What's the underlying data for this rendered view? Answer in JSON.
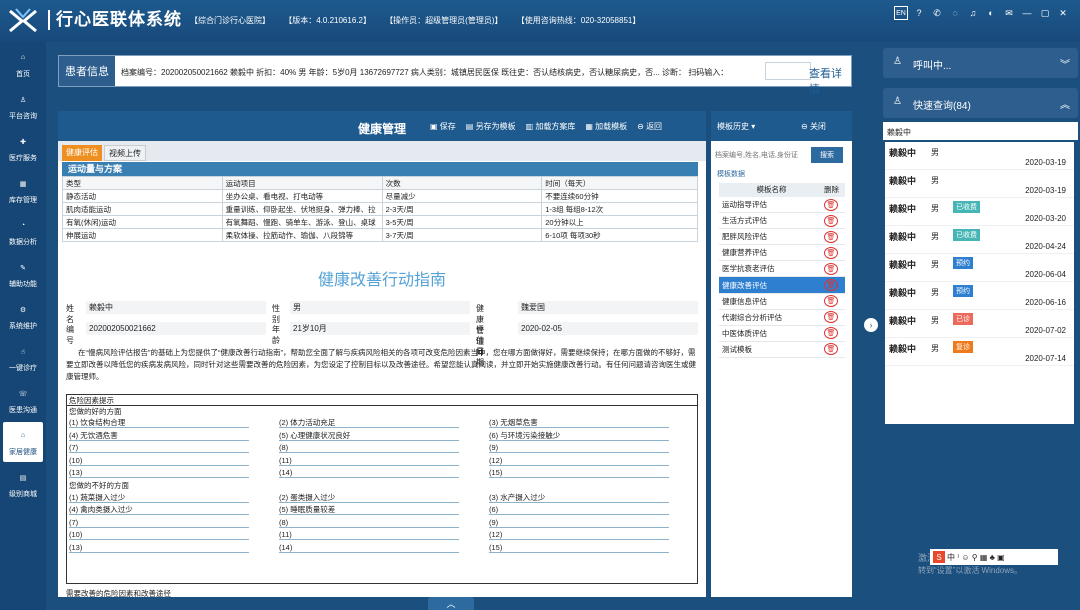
{
  "app": {
    "title": "行心医联体系统",
    "hospital": "【综合门诊行心医院】",
    "version": "【版本：4.0.210616.2】",
    "operator": "【操作员：超级管理员(管理员)】",
    "hotline": "【使用咨询热线：020-32058851】"
  },
  "top_icons": [
    "EN",
    "help-icon",
    "phone-icon",
    "chat-icon",
    "bell-icon",
    "headset-icon",
    "mail-icon",
    "minimize-icon",
    "restore-icon",
    "close-icon"
  ],
  "sidebar": [
    {
      "label": "首页",
      "icon": "home-icon"
    },
    {
      "label": "平台咨询",
      "icon": "doctor-icon"
    },
    {
      "label": "医疗服务",
      "icon": "medical-icon"
    },
    {
      "label": "库存管理",
      "icon": "warehouse-icon"
    },
    {
      "label": "数据分析",
      "icon": "chart-icon"
    },
    {
      "label": "辅助功能",
      "icon": "tools-icon"
    },
    {
      "label": "系统维护",
      "icon": "settings-icon"
    },
    {
      "label": "一键诊疗",
      "icon": "hand-icon"
    },
    {
      "label": "医患沟通",
      "icon": "chat-icon"
    },
    {
      "label": "家居健康",
      "icon": "house-icon"
    },
    {
      "label": "级别商城",
      "icon": "shop-icon"
    }
  ],
  "patient": {
    "label": "患者信息",
    "line": "档案编号：202002050021662   赖毅中   折扣：40%   男   年龄：5岁0月   13672697727   病人类别：城镇居民医保   既往史：否认结核病史，否认糖尿病史，否...   诊断：     扫码输入：",
    "detail": "查看详情"
  },
  "main": {
    "title": "健康管理",
    "buttons": [
      "保存",
      "另存为模板",
      "加载方案库",
      "加载模板",
      "返回"
    ],
    "tabs": [
      "健康评估",
      "视频上传"
    ],
    "section": "运动量与方案",
    "act_headers": [
      "类型",
      "运动项目",
      "次数",
      "时间（每天）"
    ],
    "act_rows": [
      [
        "静态活动",
        "坐办公桌、看电视、打电动等",
        "尽量减少",
        "不要连续60分钟"
      ],
      [
        "肌肉适能运动",
        "重量训练、仰卧起坐、伏地挺身、弹力棒、拉",
        "2-3天/周",
        "1-3组   每组8-12次"
      ],
      [
        "有氧(休闲)运动",
        "有氧舞蹈、慢跑、骑单车、游泳、登山、桌球",
        "3-5天/周",
        "20分钟以上"
      ],
      [
        "伸展运动",
        "柔软体操、拉筋动作、瑜伽、八段锦等",
        "3-7天/周",
        "6-10项   每项30秒"
      ]
    ],
    "guide_title": "健康改善行动指南",
    "form": {
      "name_l": "姓名",
      "name": "赖毅中",
      "sex_l": "性别",
      "sex": "男",
      "mgr_l": "健康管理师",
      "mgr": "魏爱国",
      "no_l": "编号",
      "no": "202002050021662",
      "age_l": "年龄",
      "age": "21岁10月",
      "date_l": "评估日期",
      "date": "2020-02-05"
    },
    "intro": "在“慢病风险评估报告”的基础上为您提供了“健康改善行动指南”，帮助您全面了解与疾病风险相关的各项可改变危险因素当中，您在哪方面做得好，需要继续保持；在哪方面做的不够好，需要立即改善以降低您的疾病发病风险，同时针对这些需要改善的危险因素，为您设定了控制目标以及改善途径。希望您能认真阅读，并立即开始实施健康改善行动。有任何问题请咨询医生或健康管理师。",
    "risk_header": "危险因素提示",
    "good_title": "您做的好的方面",
    "bad_title": "您做的不好的方面",
    "good": [
      [
        "(1) 饮食结构合理",
        "(2) 体力活动充足",
        "(3) 无烟草危害"
      ],
      [
        "(4) 无饮酒危害",
        "(5) 心理健康状况良好",
        "(6) 与环境污染接触少"
      ],
      [
        "(7)",
        "(8)",
        "(9)"
      ],
      [
        "(10)",
        "(11)",
        "(12)"
      ],
      [
        "(13)",
        "(14)",
        "(15)"
      ]
    ],
    "bad": [
      [
        "(1) 蔬菜摄入过少",
        "(2) 蛋类摄入过少",
        "(3) 水产摄入过少"
      ],
      [
        "(4) 禽肉类摄入过少",
        "(5) 睡眠质量较差",
        "(6)"
      ],
      [
        "(7)",
        "(8)",
        "(9)"
      ],
      [
        "(10)",
        "(11)",
        "(12)"
      ],
      [
        "(13)",
        "(14)",
        "(15)"
      ]
    ],
    "cut_text": "需要改善的危险因素和改善途径"
  },
  "template": {
    "history": "模板历史",
    "close": "关闭",
    "search_placeholder": "档案编号,姓名,电话,身份证",
    "search_btn": "搜索",
    "data_label": "模板数据",
    "col_name": "模板名称",
    "col_del": "删除",
    "items": [
      "运动指导评估",
      "生活方式评估",
      "肥胖风险评估",
      "健康营养评估",
      "医学抗衰老评估",
      "健康改善评估",
      "健康信息评估",
      "代谢综合分析评估",
      "中医体质评估",
      "测试模板"
    ],
    "selected": 5
  },
  "right": {
    "call": "呼叫中...",
    "quick": "快速查询(84)",
    "search_value": "赖毅中",
    "items": [
      {
        "name": "赖毅中",
        "sex": "男",
        "badge": "",
        "date": "2020-03-19",
        "c": ""
      },
      {
        "name": "赖毅中",
        "sex": "男",
        "badge": "",
        "date": "2020-03-19",
        "c": ""
      },
      {
        "name": "赖毅中",
        "sex": "男",
        "badge": "已收费",
        "date": "2020-03-20",
        "c": "teal"
      },
      {
        "name": "赖毅中",
        "sex": "男",
        "badge": "已收费",
        "date": "2020-04-24",
        "c": "teal"
      },
      {
        "name": "赖毅中",
        "sex": "男",
        "badge": "预约",
        "date": "2020-06-04",
        "c": "blue"
      },
      {
        "name": "赖毅中",
        "sex": "男",
        "badge": "预约",
        "date": "2020-06-16",
        "c": "blue"
      },
      {
        "name": "赖毅中",
        "sex": "男",
        "badge": "已诊",
        "date": "2020-07-02",
        "c": "red"
      },
      {
        "name": "赖毅中",
        "sex": "男",
        "badge": "复诊",
        "date": "2020-07-14",
        "c": "orange"
      }
    ]
  },
  "watermark": {
    "l1": "激活",
    "l2": "转到“设置”以激活 Windows。"
  }
}
